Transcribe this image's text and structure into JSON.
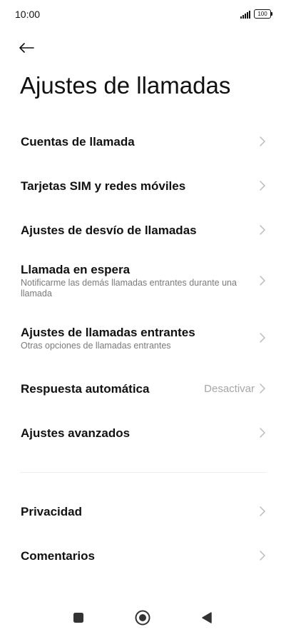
{
  "status_bar": {
    "time": "10:00",
    "battery": "100"
  },
  "header": {
    "title": "Ajustes de llamadas"
  },
  "settings": {
    "items": [
      {
        "title": "Cuentas de llamada"
      },
      {
        "title": "Tarjetas SIM y redes móviles"
      },
      {
        "title": "Ajustes de desvío de llamadas"
      },
      {
        "title": "Llamada en espera",
        "subtitle": "Notificarme las demás llamadas entrantes durante una llamada"
      },
      {
        "title": "Ajustes de llamadas entrantes",
        "subtitle": "Otras opciones de llamadas entrantes"
      },
      {
        "title": "Respuesta automática",
        "value": "Desactivar"
      },
      {
        "title": "Ajustes avanzados"
      }
    ],
    "extra_items": [
      {
        "title": "Privacidad"
      },
      {
        "title": "Comentarios"
      }
    ]
  },
  "icons": {
    "back": "arrow-left-icon",
    "chevron": "chevron-right-icon",
    "nav_recents": "square-icon",
    "nav_home": "circle-icon",
    "nav_back": "triangle-left-icon"
  },
  "colors": {
    "text_primary": "#111111",
    "text_secondary": "#7a7a7a",
    "chevron": "#b8b8b8",
    "divider": "#eeeeee",
    "nav_icons": "#333333"
  }
}
